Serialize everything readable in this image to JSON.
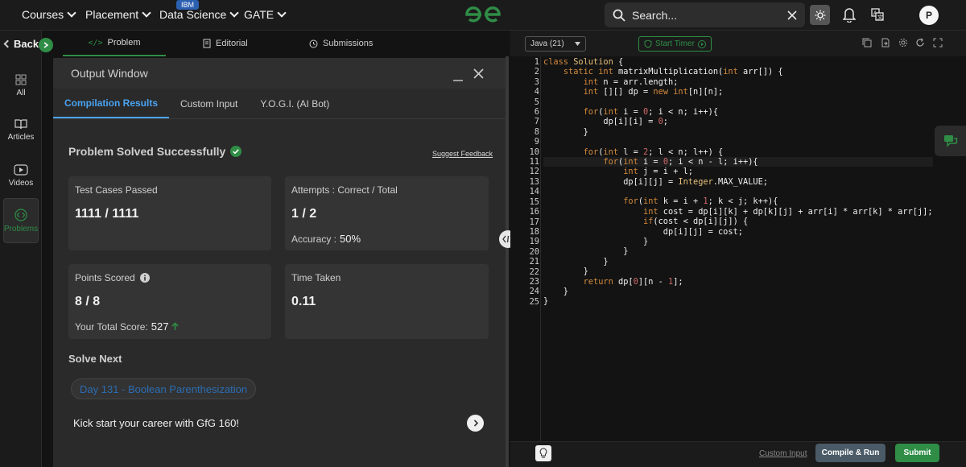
{
  "topnav": {
    "items": [
      {
        "label": "Courses"
      },
      {
        "label": "Placement"
      },
      {
        "label": "Data Science"
      },
      {
        "label": "GATE"
      }
    ],
    "ibm_badge": "IBM",
    "search_placeholder": "Search...",
    "avatar_letter": "P"
  },
  "sidebar": {
    "back_label": "Back",
    "items": [
      {
        "label": "All",
        "icon": "grid-icon"
      },
      {
        "label": "Articles",
        "icon": "book-icon"
      },
      {
        "label": "Videos",
        "icon": "video-icon"
      },
      {
        "label": "Problems",
        "icon": "code-icon",
        "active": true
      }
    ]
  },
  "problem_tabs": [
    {
      "label": "Problem",
      "active": true
    },
    {
      "label": "Editorial"
    },
    {
      "label": "Submissions"
    }
  ],
  "output_window": {
    "title": "Output Window",
    "tabs": [
      "Compilation Results",
      "Custom Input",
      "Y.O.G.I. (AI Bot)"
    ],
    "result_title": "Problem Solved Successfully",
    "suggest_feedback": "Suggest Feedback",
    "cards": {
      "test_cases": {
        "label": "Test Cases Passed",
        "value": "1111 / 1111"
      },
      "attempts": {
        "label": "Attempts : Correct / Total",
        "value": "1 / 2",
        "sub_label": "Accuracy :",
        "sub_value": "50%"
      },
      "points": {
        "label": "Points Scored",
        "value": "8 / 8",
        "sub_label": "Your Total Score:",
        "sub_value": "527"
      },
      "time": {
        "label": "Time Taken",
        "value": "0.11"
      }
    },
    "solve_next_label": "Solve Next",
    "next_problem": "Day 131 - Boolean Parenthesization",
    "kick_start": "Kick start your career with GfG 160!"
  },
  "editor": {
    "language": "Java (21)",
    "timer_label": "Start Timer",
    "code_lines": [
      "class Solution {",
      "    static int matrixMultiplication(int arr[]) {",
      "        int n = arr.length;",
      "        int [][] dp = new int[n][n];",
      "",
      "        for(int i = 0; i < n; i++){",
      "            dp[i][i] = 0;",
      "        }",
      "",
      "        for(int l = 2; l < n; l++) {",
      "            for(int i = 0; i < n - l; i++){",
      "                int j = i + l;",
      "                dp[i][j] = Integer.MAX_VALUE;",
      "",
      "                for(int k = i + 1; k < j; k++){",
      "                    int cost = dp[i][k] + dp[k][j] + arr[i] * arr[k] * arr[j];",
      "                    if(cost < dp[i][j]) {",
      "                        dp[i][j] = cost;",
      "                    }",
      "                }",
      "            }",
      "        }",
      "        return dp[0][n - 1];",
      "    }",
      "}"
    ],
    "highlighted_line": 11,
    "custom_input_link": "Custom Input",
    "compile_label": "Compile & Run",
    "submit_label": "Submit"
  },
  "colors": {
    "brand_green": "#2f8d46",
    "link_blue": "#4aa3f0",
    "keyword": "#d48a3d"
  }
}
